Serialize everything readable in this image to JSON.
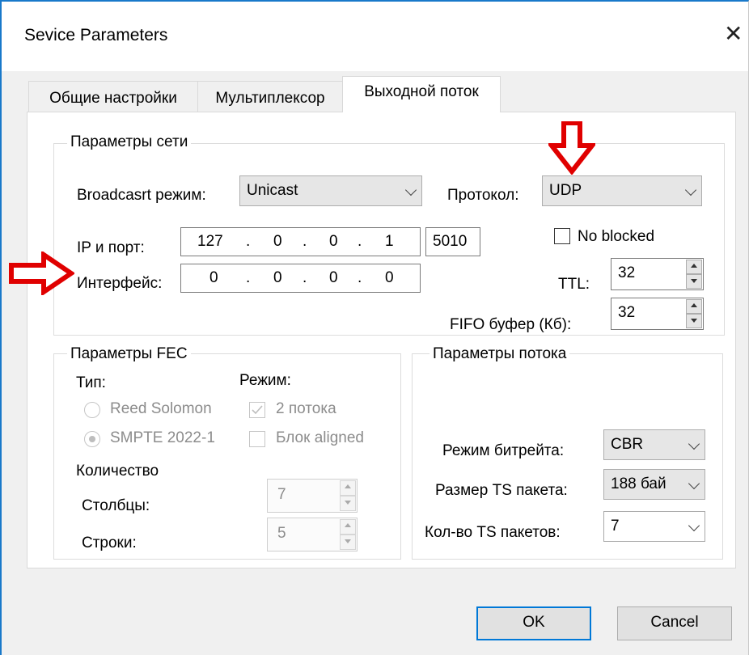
{
  "window": {
    "title": "Sevice Parameters",
    "close_glyph": "✕"
  },
  "tabs": [
    {
      "label": "Общие настройки",
      "active": false
    },
    {
      "label": "Мультиплексор",
      "active": false
    },
    {
      "label": "Выходной поток",
      "active": true
    }
  ],
  "network": {
    "group_title": "Параметры сети",
    "broadcast_label": "Broadcasrt режим:",
    "broadcast_value": "Unicast",
    "protocol_label": "Протокол:",
    "protocol_value": "UDP",
    "ip_port_label": "IP и порт:",
    "ip_octets": [
      "127",
      "0",
      "0",
      "1"
    ],
    "ip_dot": ".",
    "port": "5010",
    "no_blocked_label": "No blocked",
    "no_blocked_checked": false,
    "interface_label": "Интерфейс:",
    "interface_octets": [
      "0",
      "0",
      "0",
      "0"
    ],
    "ttl_label": "TTL:",
    "ttl_value": "32",
    "fifo_label": "FIFO буфер (Кб):",
    "fifo_value": "32"
  },
  "fec": {
    "group_title": "Параметры FEC",
    "type_label": "Тип:",
    "mode_label": "Режим:",
    "radio_reed": "Reed Solomon",
    "radio_smpte": "SMPTE 2022-1",
    "check_2streams": "2 потока",
    "check_block": "Блок aligned",
    "count_label": "Количество",
    "columns_label": "Столбцы:",
    "columns_value": "7",
    "rows_label": "Строки:",
    "rows_value": "5"
  },
  "stream": {
    "group_title": "Параметры потока",
    "bitrate_label": "Режим битрейта:",
    "bitrate_value": "CBR",
    "ts_size_label": "Размер TS пакета:",
    "ts_size_value": "188 бай",
    "ts_count_label": "Кол-во TS пакетов:",
    "ts_count_value": "7"
  },
  "buttons": {
    "ok": "OK",
    "cancel": "Cancel"
  },
  "colors": {
    "annotation_arrow": "#e00000",
    "accent": "#0078d7"
  }
}
